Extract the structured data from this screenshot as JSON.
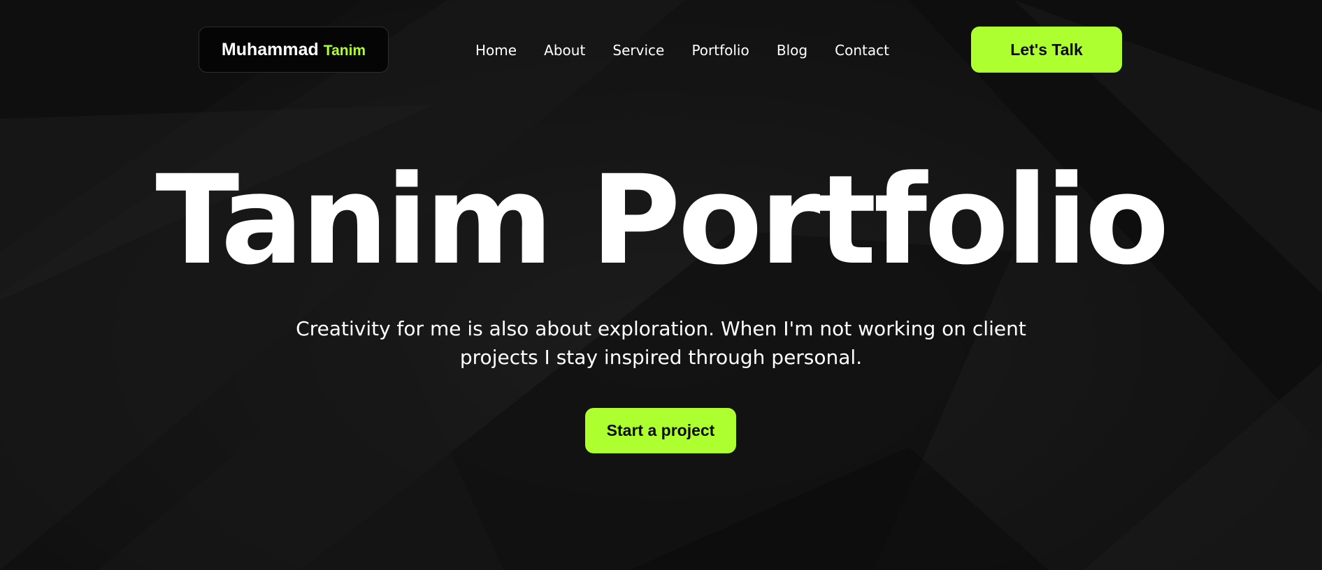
{
  "colors": {
    "accent": "#adff2f",
    "background": "#141414",
    "text": "#ffffff"
  },
  "brand": {
    "first_name": "Muhammad",
    "last_name": "Tanim"
  },
  "nav": {
    "items": [
      {
        "label": "Home"
      },
      {
        "label": "About"
      },
      {
        "label": "Service"
      },
      {
        "label": "Portfolio"
      },
      {
        "label": "Blog"
      },
      {
        "label": "Contact"
      }
    ],
    "cta_label": "Let's Talk"
  },
  "hero": {
    "title": "Tanim Portfolio",
    "subtitle": "Creativity for me is also about exploration. When I'm not working on client projects I stay inspired through personal.",
    "cta_label": "Start a project"
  }
}
